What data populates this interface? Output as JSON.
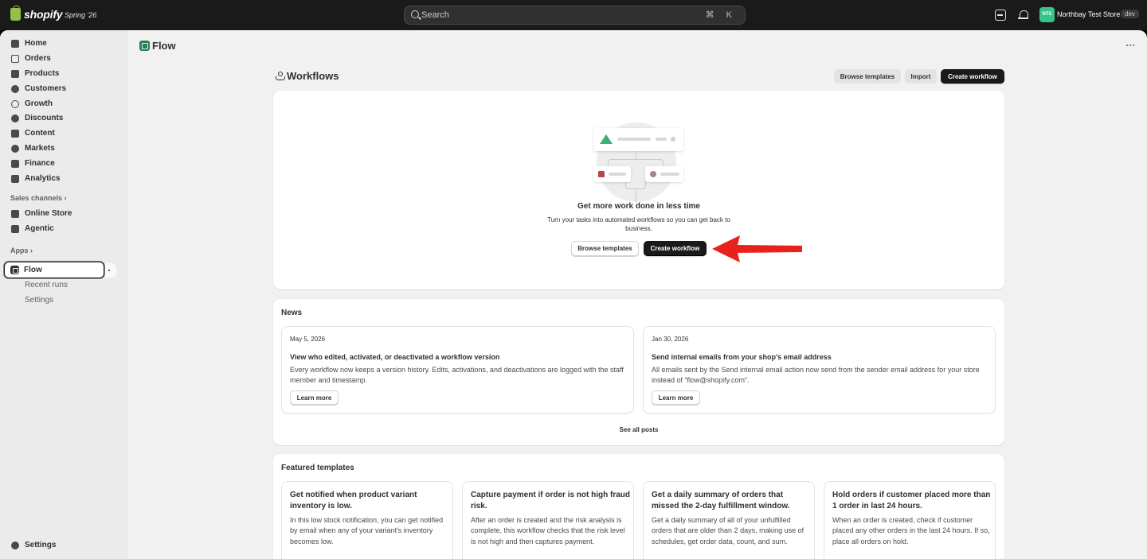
{
  "topbar": {
    "logo_text": "shopify",
    "edition": "Spring '26",
    "search_placeholder": "Search",
    "shortcut": "⌘ K",
    "store_avatar": "NTS",
    "store_name": "Northbay Test Store",
    "store_badge": "dev"
  },
  "sidebar": {
    "items": [
      {
        "label": "Home",
        "icon": "home-icon"
      },
      {
        "label": "Orders",
        "icon": "orders-icon"
      },
      {
        "label": "Products",
        "icon": "products-icon"
      },
      {
        "label": "Customers",
        "icon": "customers-icon"
      },
      {
        "label": "Growth",
        "icon": "growth-icon"
      },
      {
        "label": "Discounts",
        "icon": "discounts-icon"
      },
      {
        "label": "Content",
        "icon": "content-icon"
      },
      {
        "label": "Markets",
        "icon": "markets-icon"
      },
      {
        "label": "Finance",
        "icon": "finance-icon"
      },
      {
        "label": "Analytics",
        "icon": "analytics-icon"
      }
    ],
    "sales_channels_label": "Sales channels",
    "channels": [
      {
        "label": "Online Store",
        "icon": "online-store-icon"
      },
      {
        "label": "Agentic",
        "icon": "agentic-icon"
      }
    ],
    "apps_label": "Apps",
    "flow_label": "Flow",
    "flow_subitems": [
      "Recent runs",
      "Settings"
    ],
    "settings_label": "Settings"
  },
  "main": {
    "app_title": "Flow",
    "page_title": "Workflows",
    "actions": {
      "browse_templates": "Browse templates",
      "import": "Import",
      "create_workflow": "Create workflow"
    },
    "empty_state": {
      "heading": "Get more work done in less time",
      "body": "Turn your tasks into automated workflows so you can get back to business.",
      "browse_templates": "Browse templates",
      "create_workflow": "Create workflow"
    },
    "news": {
      "title": "News",
      "items": [
        {
          "date": "May 5, 2026",
          "title": "View who edited, activated, or deactivated a workflow version",
          "body": "Every workflow now keeps a version history. Edits, activations, and deactivations are logged with the staff member and timestamp.",
          "cta": "Learn more"
        },
        {
          "date": "Jan 30, 2026",
          "title": "Send internal emails from your shop's email address",
          "body": "All emails sent by the Send internal email action now send from the sender email address for your store instead of “flow@shopify.com”.",
          "cta": "Learn more"
        }
      ],
      "see_all": "See all posts"
    },
    "featured": {
      "title": "Featured templates",
      "items": [
        {
          "title": "Get notified when product variant inventory is low.",
          "body": "In this low stock notification, you can get notified by email when any of your variant's inventory becomes low."
        },
        {
          "title": "Capture payment if order is not high fraud risk.",
          "body": "After an order is created and the risk analysis is complete, this workflow checks that the risk level is not high and then captures payment."
        },
        {
          "title": "Get a daily summary of orders that missed the 2-day fulfillment window.",
          "body": "Get a daily summary of all of your unfulfilled orders that are older than 2 days, making use of schedules, get order data, count, and sum."
        },
        {
          "title": "Hold orders if customer placed more than 1 order in last 24 hours.",
          "body": "When an order is created, check if customer placed any other orders in the last 24 hours. If so, place all orders on hold."
        }
      ]
    }
  },
  "colors": {
    "topbar_bg": "#1a1a1a",
    "sidebar_bg": "#ebebeb",
    "page_bg": "#f1f1f1",
    "primary_button": "#1a1a1a",
    "annotation_arrow": "#e8221b",
    "flow_green": "#36c48a"
  }
}
